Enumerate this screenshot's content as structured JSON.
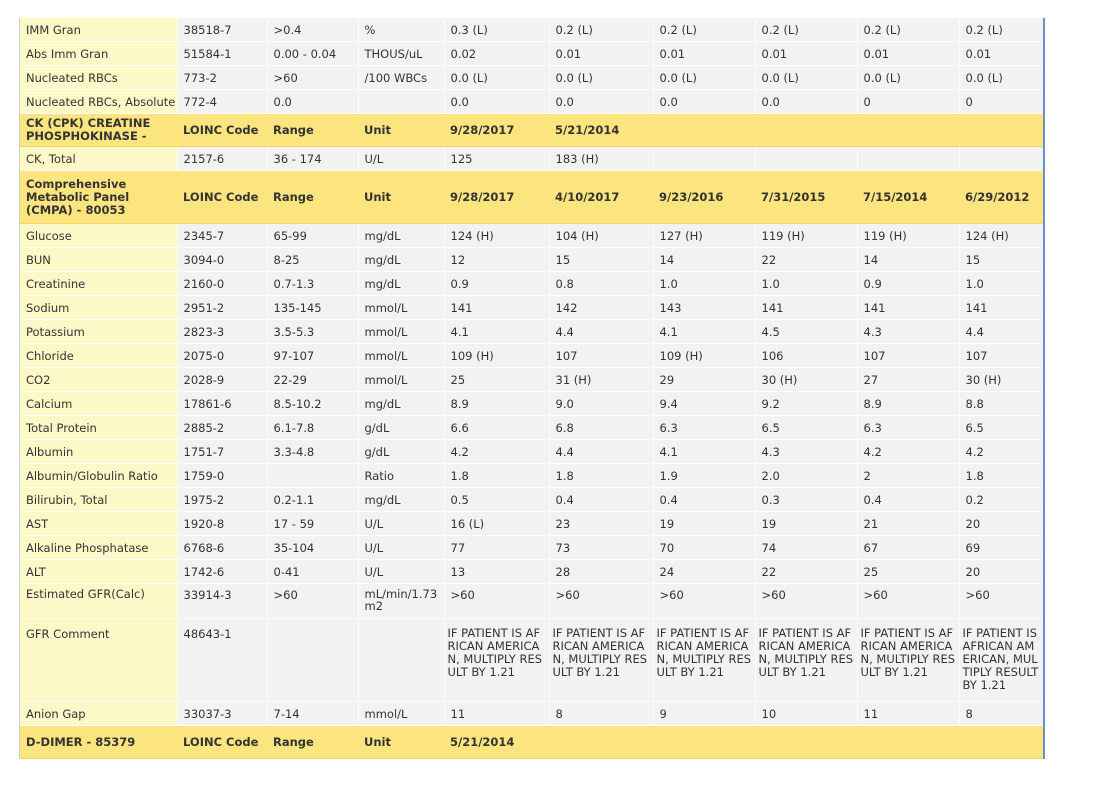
{
  "rows": [
    {
      "type": "data",
      "name": "IMM Gran",
      "loinc": "38518-7",
      "range": ">0.4",
      "unit": "%",
      "values": [
        "0.3 (L)",
        "0.2 (L)",
        "0.2 (L)",
        "0.2 (L)",
        "0.2 (L)",
        "0.2 (L)"
      ]
    },
    {
      "type": "data",
      "name": "Abs Imm Gran",
      "loinc": "51584-1",
      "range": "0.00 - 0.04",
      "unit": "THOUS/uL",
      "values": [
        "0.02",
        "0.01",
        "0.01",
        "0.01",
        "0.01",
        "0.01"
      ]
    },
    {
      "type": "data",
      "name": "Nucleated RBCs",
      "loinc": "773-2",
      "range": ">60",
      "unit": "/100 WBCs",
      "values": [
        "0.0 (L)",
        "0.0 (L)",
        "0.0 (L)",
        "0.0 (L)",
        "0.0 (L)",
        "0.0 (L)"
      ]
    },
    {
      "type": "data",
      "name": "Nucleated RBCs, Absolute",
      "loinc": "772-4",
      "range": "0.0",
      "unit": "",
      "values": [
        "0.0",
        "0.0",
        "0.0",
        "0.0",
        "0",
        "0"
      ]
    },
    {
      "type": "header",
      "name": "CK (CPK) CREATINE PHOSPHOKINASE -",
      "loinc": "LOINC Code",
      "range": "Range",
      "unit": "Unit",
      "values": [
        "9/28/2017",
        "5/21/2014",
        "",
        "",
        "",
        ""
      ]
    },
    {
      "type": "data",
      "name": "CK, Total",
      "loinc": "2157-6",
      "range": "36 - 174",
      "unit": "U/L",
      "values": [
        "125",
        "183 (H)",
        "",
        "",
        "",
        ""
      ]
    },
    {
      "type": "header",
      "name": "Comprehensive Metabolic Panel (CMPA) - 80053",
      "loinc": "LOINC Code",
      "range": "Range",
      "unit": "Unit",
      "values": [
        "9/28/2017",
        "4/10/2017",
        "9/23/2016",
        "7/31/2015",
        "7/15/2014",
        "6/29/2012"
      ]
    },
    {
      "type": "data",
      "name": "Glucose",
      "loinc": "2345-7",
      "range": "65-99",
      "unit": "mg/dL",
      "values": [
        "124 (H)",
        "104 (H)",
        "127 (H)",
        "119 (H)",
        "119 (H)",
        "124 (H)"
      ]
    },
    {
      "type": "data",
      "name": "BUN",
      "loinc": "3094-0",
      "range": "8-25",
      "unit": "mg/dL",
      "values": [
        "12",
        "15",
        "14",
        "22",
        "14",
        "15"
      ]
    },
    {
      "type": "data",
      "name": "Creatinine",
      "loinc": "2160-0",
      "range": "0.7-1.3",
      "unit": "mg/dL",
      "values": [
        "0.9",
        "0.8",
        "1.0",
        "1.0",
        "0.9",
        "1.0"
      ]
    },
    {
      "type": "data",
      "name": "Sodium",
      "loinc": "2951-2",
      "range": "135-145",
      "unit": "mmol/L",
      "values": [
        "141",
        "142",
        "143",
        "141",
        "141",
        "141"
      ]
    },
    {
      "type": "data",
      "name": "Potassium",
      "loinc": "2823-3",
      "range": "3.5-5.3",
      "unit": "mmol/L",
      "values": [
        "4.1",
        "4.4",
        "4.1",
        "4.5",
        "4.3",
        "4.4"
      ]
    },
    {
      "type": "data",
      "name": "Chloride",
      "loinc": "2075-0",
      "range": "97-107",
      "unit": "mmol/L",
      "values": [
        "109 (H)",
        "107",
        "109 (H)",
        "106",
        "107",
        "107"
      ]
    },
    {
      "type": "data",
      "name": "CO2",
      "loinc": "2028-9",
      "range": "22-29",
      "unit": "mmol/L",
      "values": [
        "25",
        "31 (H)",
        "29",
        "30 (H)",
        "27",
        "30 (H)"
      ]
    },
    {
      "type": "data",
      "name": "Calcium",
      "loinc": "17861-6",
      "range": "8.5-10.2",
      "unit": "mg/dL",
      "values": [
        "8.9",
        "9.0",
        "9.4",
        "9.2",
        "8.9",
        "8.8"
      ]
    },
    {
      "type": "data",
      "name": "Total Protein",
      "loinc": "2885-2",
      "range": "6.1-7.8",
      "unit": "g/dL",
      "values": [
        "6.6",
        "6.8",
        "6.3",
        "6.5",
        "6.3",
        "6.5"
      ]
    },
    {
      "type": "data",
      "name": "Albumin",
      "loinc": "1751-7",
      "range": "3.3-4.8",
      "unit": "g/dL",
      "values": [
        "4.2",
        "4.4",
        "4.1",
        "4.3",
        "4.2",
        "4.2"
      ]
    },
    {
      "type": "data",
      "name": "Albumin/Globulin Ratio",
      "loinc": "1759-0",
      "range": "",
      "unit": "Ratio",
      "values": [
        "1.8",
        "1.8",
        "1.9",
        "2.0",
        "2",
        "1.8"
      ]
    },
    {
      "type": "data",
      "name": "Bilirubin, Total",
      "loinc": "1975-2",
      "range": "0.2-1.1",
      "unit": "mg/dL",
      "values": [
        "0.5",
        "0.4",
        "0.4",
        "0.3",
        "0.4",
        "0.2"
      ]
    },
    {
      "type": "data",
      "name": "AST",
      "loinc": "1920-8",
      "range": "17 - 59",
      "unit": "U/L",
      "values": [
        "16 (L)",
        "23",
        "19",
        "19",
        "21",
        "20"
      ]
    },
    {
      "type": "data",
      "name": "Alkaline Phosphatase",
      "loinc": "6768-6",
      "range": "35-104",
      "unit": "U/L",
      "values": [
        "77",
        "73",
        "70",
        "74",
        "67",
        "69"
      ]
    },
    {
      "type": "data",
      "name": "ALT",
      "loinc": "1742-6",
      "range": "0-41",
      "unit": "U/L",
      "values": [
        "13",
        "28",
        "24",
        "22",
        "25",
        "20"
      ]
    },
    {
      "type": "data",
      "name": "Estimated GFR(Calc)",
      "loinc": "33914-3",
      "range": ">60",
      "unit": "mL/min/1.73 m2",
      "values": [
        ">60",
        ">60",
        ">60",
        ">60",
        ">60",
        ">60"
      ]
    },
    {
      "type": "data",
      "name": "GFR Comment",
      "loinc": "48643-1",
      "range": "",
      "unit": "",
      "values": [
        "IF PATIENT IS AFRICAN AMERICAN, MULTIPLY RESULT BY 1.21",
        "IF PATIENT IS AFRICAN AMERICAN, MULTIPLY RESULT BY 1.21",
        "IF PATIENT IS AFRICAN AMERICAN, MULTIPLY RESULT BY 1.21",
        "IF PATIENT IS AFRICAN AMERICAN, MULTIPLY RESULT BY 1.21",
        "IF PATIENT IS AFRICAN AMERICAN, MULTIPLY RESULT BY 1.21",
        "IF PATIENT IS AFRICAN AMERICAN, MULTIPLY RESULT BY 1.21"
      ]
    },
    {
      "type": "data",
      "name": "Anion Gap",
      "loinc": "33037-3",
      "range": "7-14",
      "unit": "mmol/L",
      "values": [
        "11",
        "8",
        "9",
        "10",
        "11",
        "8"
      ]
    },
    {
      "type": "header",
      "name": "D-DIMER - 85379",
      "loinc": "LOINC Code",
      "range": "Range",
      "unit": "Unit",
      "values": [
        "5/21/2014",
        "",
        "",
        "",
        "",
        ""
      ]
    }
  ],
  "colors": {
    "header_bg": "#fce47f",
    "name_bg": "#fdf8c8",
    "cell_bg": "#f2f2f2",
    "right_border": "#6b8fc9"
  }
}
